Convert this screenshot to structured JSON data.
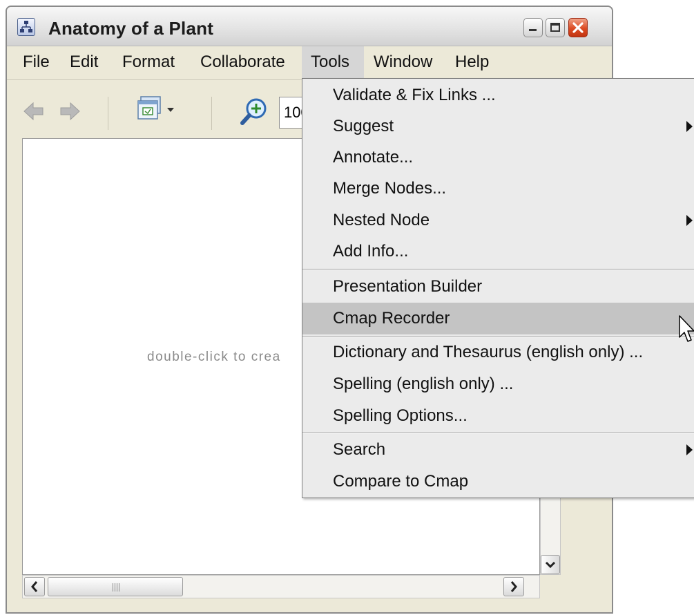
{
  "window": {
    "title": "Anatomy of a Plant"
  },
  "menubar": {
    "items": [
      "File",
      "Edit",
      "Format",
      "Collaborate",
      "Tools",
      "Window",
      "Help"
    ],
    "active": "Tools"
  },
  "toolbar": {
    "zoom_value": "100%"
  },
  "canvas": {
    "hint": "double-click to crea"
  },
  "tools_menu": {
    "items": [
      {
        "label": "Validate & Fix Links ...",
        "submenu": false
      },
      {
        "label": "Suggest",
        "submenu": true
      },
      {
        "label": "Annotate...",
        "submenu": false
      },
      {
        "label": "Merge Nodes...",
        "submenu": false
      },
      {
        "label": "Nested Node",
        "submenu": true
      },
      {
        "label": "Add Info...",
        "submenu": false
      },
      {
        "label": "Presentation Builder",
        "submenu": false
      },
      {
        "label": "Cmap Recorder",
        "submenu": false,
        "highlighted": true
      },
      {
        "label": "Dictionary and Thesaurus (english only) ...",
        "submenu": false
      },
      {
        "label": "Spelling (english only) ...",
        "submenu": false
      },
      {
        "label": "Spelling Options...",
        "submenu": false
      },
      {
        "label": "Search",
        "submenu": true
      },
      {
        "label": "Compare to Cmap",
        "submenu": false
      }
    ]
  },
  "colors": {
    "window_bg": "#ece9d8",
    "menu_bg": "#ebebeb",
    "menu_highlight": "#c4c4c4",
    "close_button": "#dc4a22"
  }
}
